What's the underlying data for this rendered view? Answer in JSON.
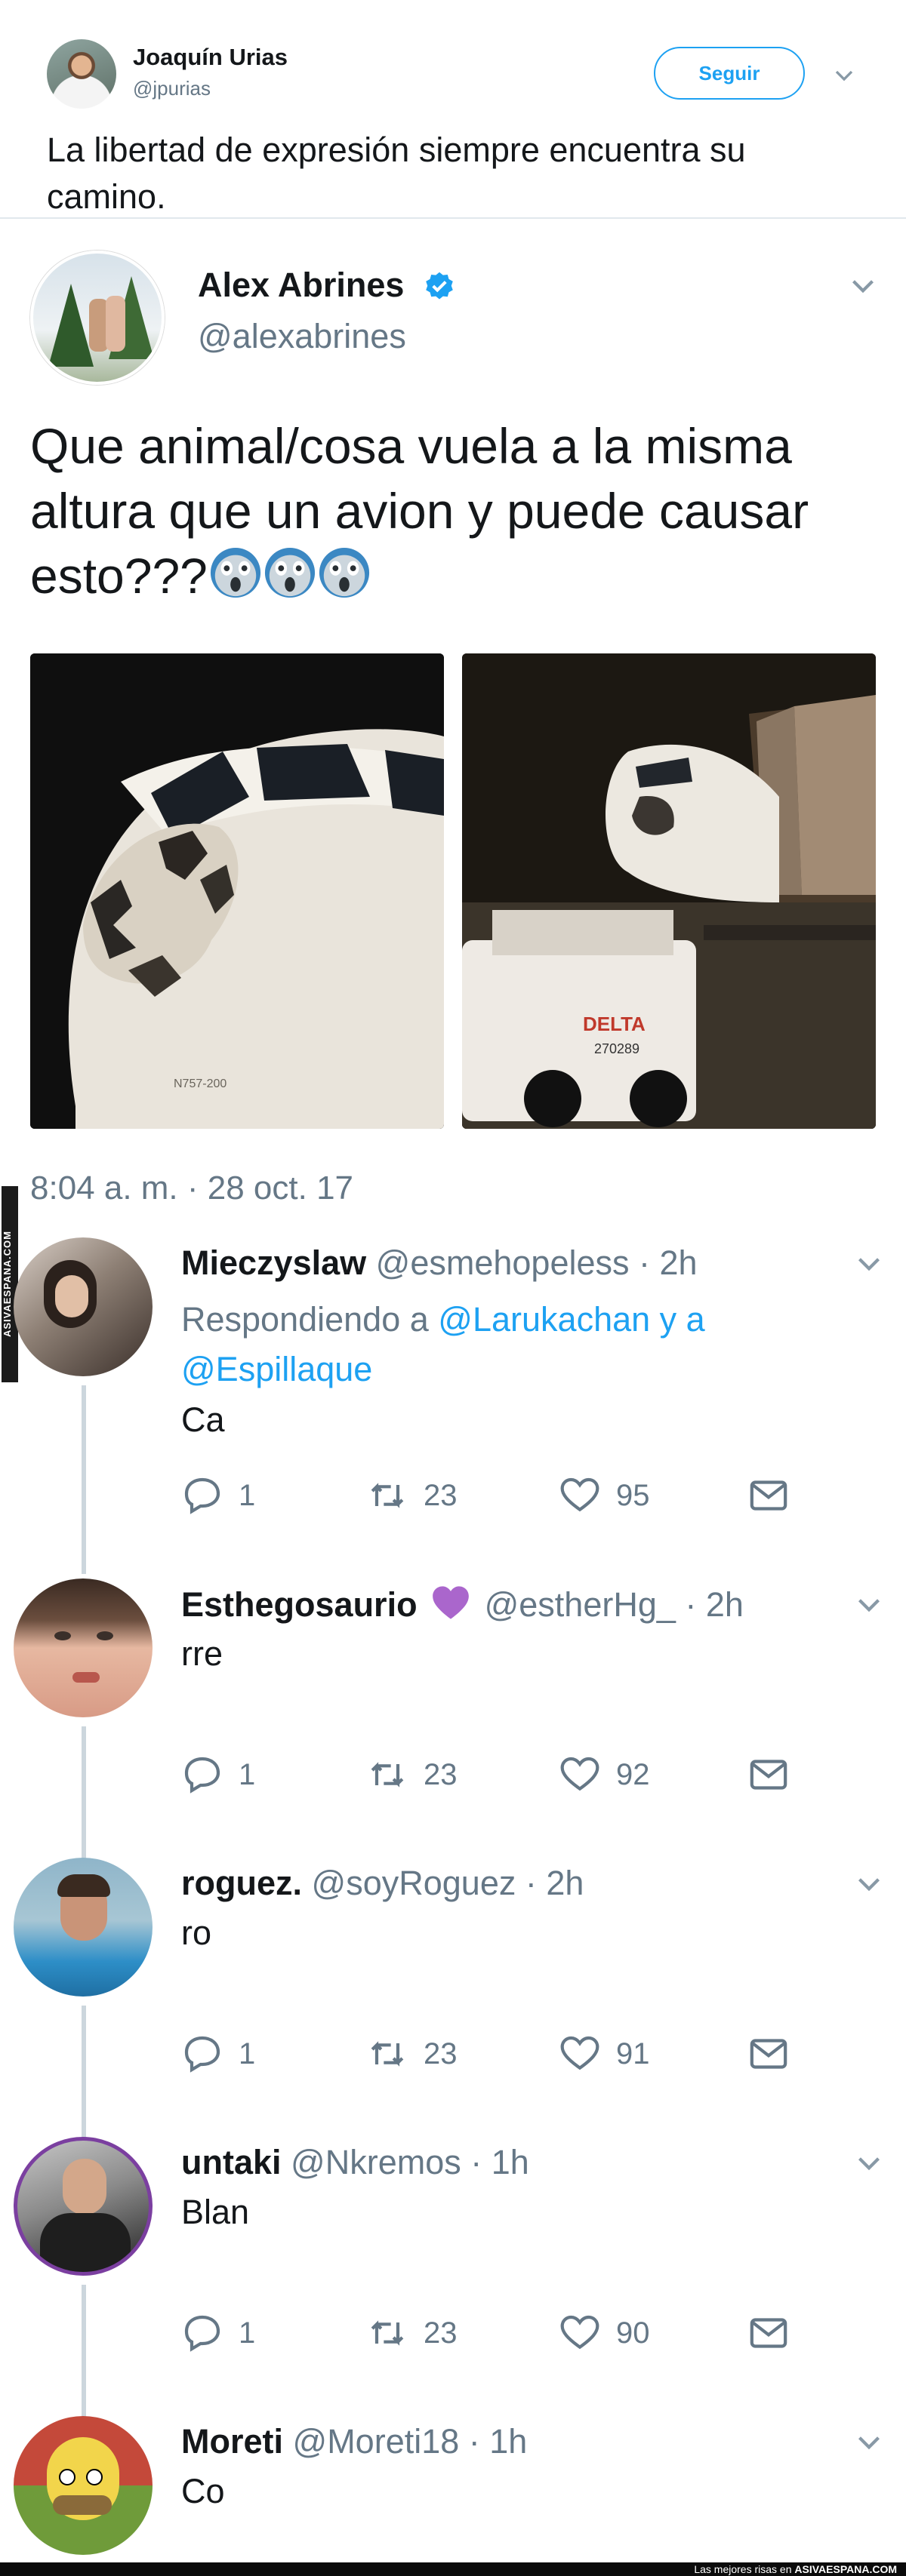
{
  "top_tweet": {
    "name": "Joaquín Urias",
    "handle": "@jpurias",
    "follow_label": "Seguir",
    "text": "La libertad de expresión siempre encuentra su camino."
  },
  "quoted_tweet": {
    "name": "Alex Abrines",
    "handle": "@alexabrines",
    "text": "Que animal/cosa vuela a la misma altura que un avion y puede causar esto???",
    "timestamp": "8:04 a. m. · 28 oct. 17",
    "photo2_label": "DELTA",
    "photo2_code": "270289",
    "photo1_code": "N757-200"
  },
  "replies": [
    {
      "name": "Mieczyslaw",
      "handle": "@esmehopeless",
      "time": "· 2h",
      "replying_prefix": "Respondiendo a",
      "mention1": "@Larukachan",
      "connector": "y a",
      "mention2": "@Espillaque",
      "text": "Ca",
      "replies": "1",
      "retweets": "23",
      "likes": "95"
    },
    {
      "name": "Esthegosaurio",
      "handle": "@estherHg_",
      "time": "· 2h",
      "text": "rre",
      "replies": "1",
      "retweets": "23",
      "likes": "92"
    },
    {
      "name": "roguez.",
      "handle": "@soyRoguez",
      "time": "· 2h",
      "text": "ro",
      "replies": "1",
      "retweets": "23",
      "likes": "91"
    },
    {
      "name": "untaki",
      "handle": "@Nkremos",
      "time": "· 1h",
      "text": "Blan",
      "replies": "1",
      "retweets": "23",
      "likes": "90"
    },
    {
      "name": "Moreti",
      "handle": "@Moreti18",
      "time": "· 1h",
      "text": "Co"
    }
  ],
  "watermark": {
    "side": "ASIVAESPANA.COM",
    "footer_prefix": "Las mejores risas en",
    "footer_site": "ASIVAESPANA.COM"
  },
  "colors": {
    "accent": "#1da1f2",
    "secondary_text": "#657786",
    "primary_text": "#14171a",
    "divider": "#e1e8ed"
  },
  "icons": [
    "chevron-down-icon",
    "verified-badge-icon",
    "reply-icon",
    "retweet-icon",
    "like-icon",
    "direct-message-icon",
    "purple-heart-icon",
    "scream-emoji-icon"
  ]
}
